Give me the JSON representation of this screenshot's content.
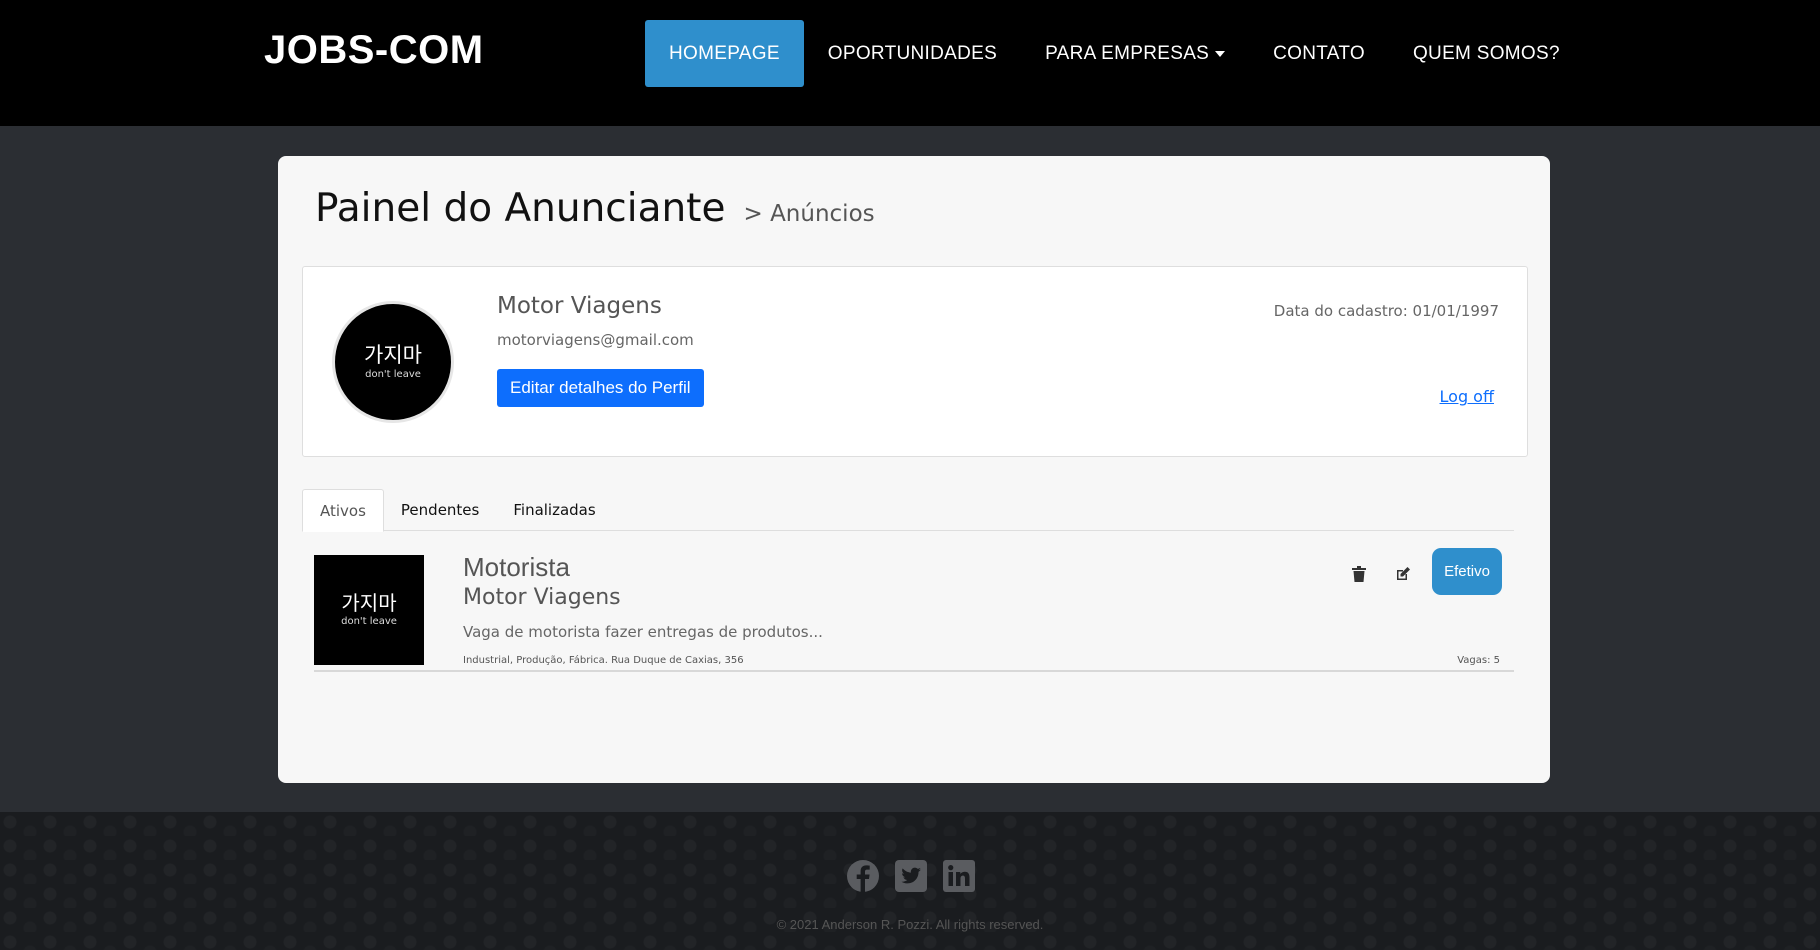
{
  "header": {
    "brand": "JOBS-COM",
    "nav": [
      {
        "label": "HOMEPAGE"
      },
      {
        "label": "OPORTUNIDADES"
      },
      {
        "label": "PARA EMPRESAS"
      },
      {
        "label": "CONTATO"
      },
      {
        "label": "QUEM SOMOS?"
      }
    ]
  },
  "page": {
    "title": "Painel do Anunciante",
    "breadcrumb": "> Anúncios"
  },
  "profile": {
    "logo_text": "가지마",
    "logo_sub": "don't leave",
    "name": "Motor Viagens",
    "email": "motorviagens@gmail.com",
    "edit_label": "Editar detalhes do Perfil",
    "register_date": "Data do cadastro: 01/01/1997",
    "logoff_label": "Log off"
  },
  "tabs": [
    {
      "label": "Ativos"
    },
    {
      "label": "Pendentes"
    },
    {
      "label": "Finalizadas"
    }
  ],
  "jobs": [
    {
      "logo_text": "가지마",
      "logo_sub": "don't leave",
      "title": "Motorista",
      "company": "Motor Viagens",
      "description": "Vaga de motorista fazer entregas de produtos...",
      "tags": "Industrial, Produção, Fábrica. Rua Duque de Caxias, 356",
      "vagas": "Vagas: 5",
      "type_label": "Efetivo"
    }
  ],
  "footer": {
    "copyright": "© 2021 Anderson R. Pozzi. All rights reserved."
  },
  "colors": {
    "accent": "#2f8fcc",
    "primary_button": "#0d6efd",
    "header_bg": "#000000",
    "page_bg": "#2b2e33"
  }
}
